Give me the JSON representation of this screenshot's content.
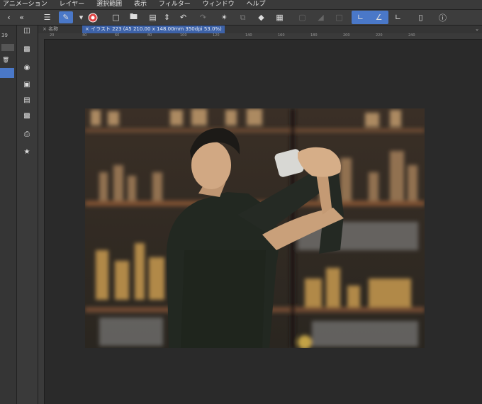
{
  "menubar": {
    "items": [
      "アニメーション",
      "レイヤー",
      "選択範囲",
      "表示",
      "フィルター",
      "ウィンドウ",
      "ヘルプ"
    ]
  },
  "tab": {
    "inactive_label": "× 名称",
    "active_label": "× イラスト 223 (A5 210.00 x 148.00mm 350dpi 53.0%)"
  },
  "ruler": {
    "ticks": [
      "20",
      "40",
      "60",
      "80",
      "100",
      "120",
      "140",
      "160",
      "180",
      "200",
      "220",
      "240"
    ]
  },
  "leftcol": {
    "values": [
      "39",
      "",
      "",
      "",
      "",
      "",
      "",
      "",
      "",
      "",
      "",
      "",
      "",
      ""
    ]
  },
  "colors": {
    "accent": "#4a78c8",
    "tab_active": "#3d62a8",
    "background": "#2b2b2b"
  }
}
